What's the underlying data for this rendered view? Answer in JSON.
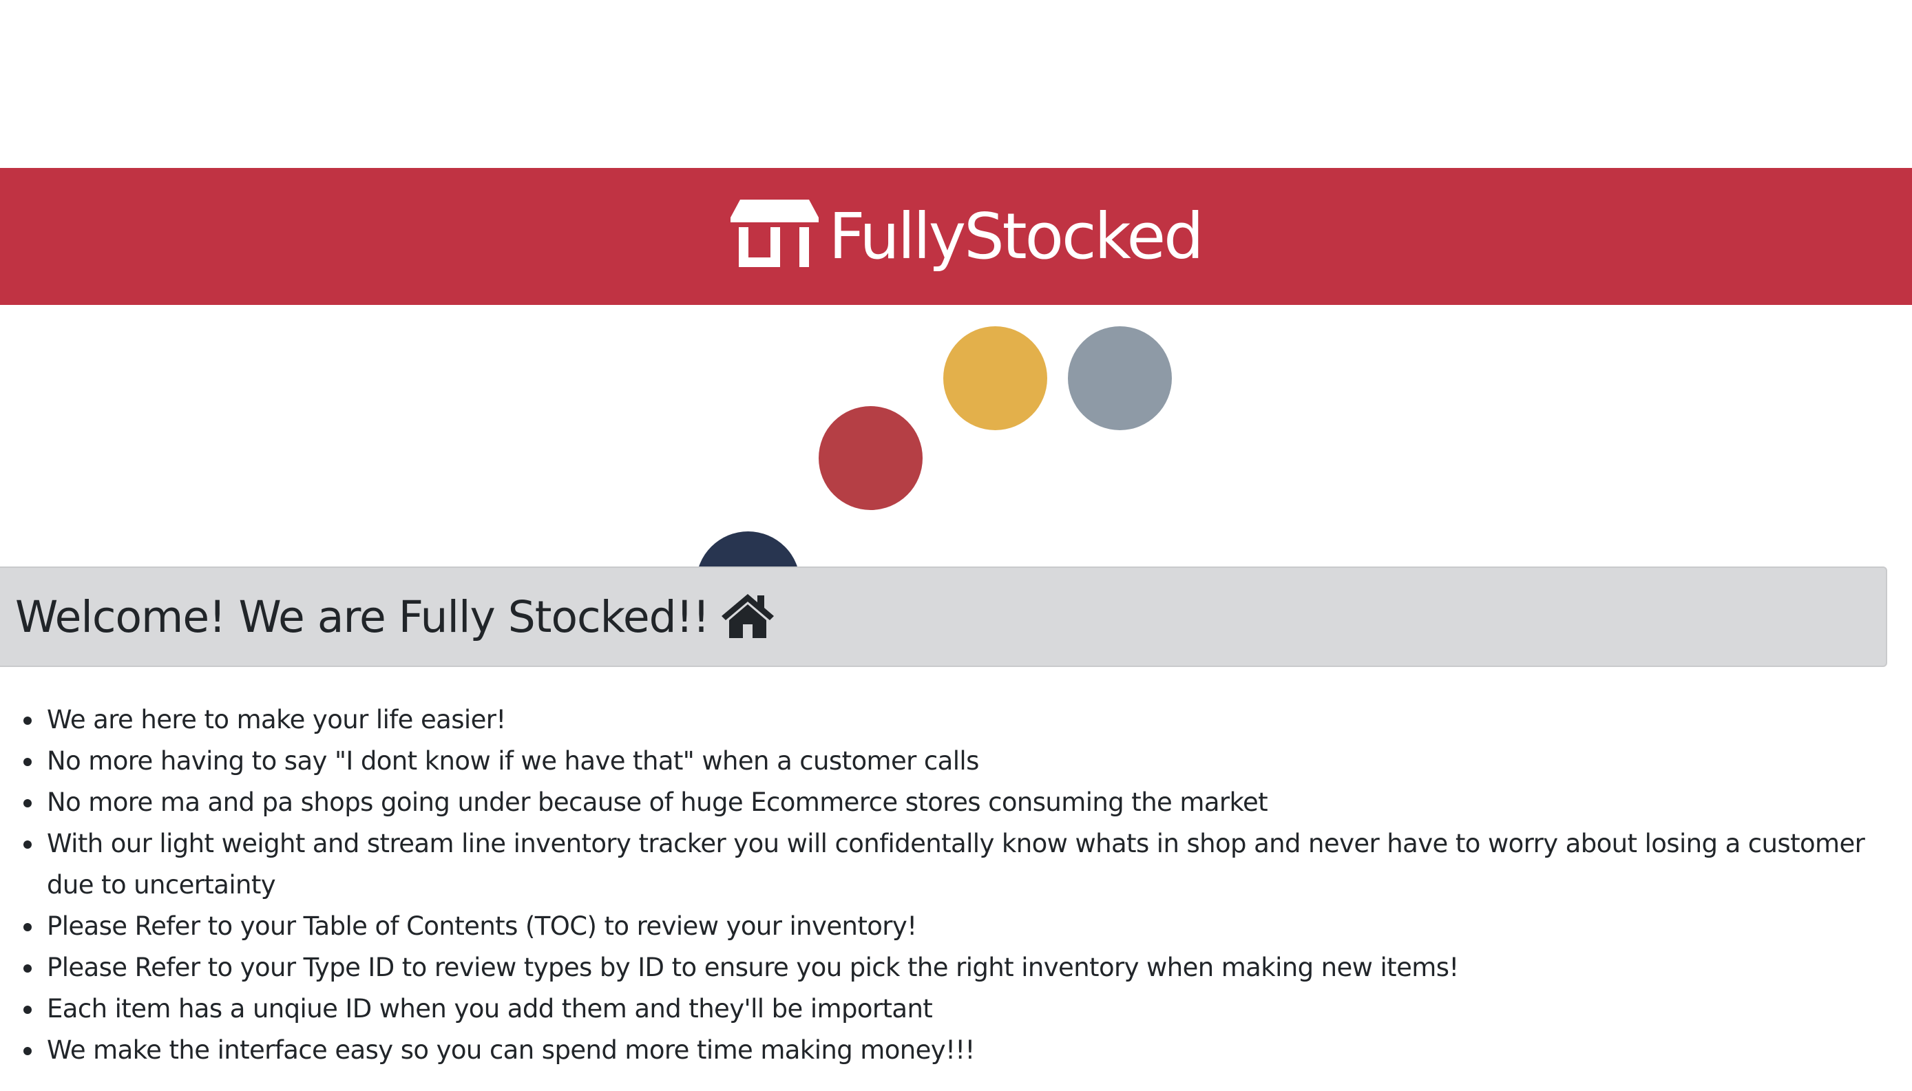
{
  "header": {
    "brand_name": "FullyStocked",
    "brand_icon": "store-icon",
    "background_color": "#c03343"
  },
  "decoration": {
    "dot_colors": [
      "#e3b04b",
      "#8e9aa6",
      "#b53f45",
      "#283550"
    ]
  },
  "jumbotron": {
    "title": "Welcome! We are Fully Stocked!!",
    "title_icon": "home-icon",
    "background_color": "#d8d9db"
  },
  "features": [
    "We are here to make your life easier!",
    "No more having to say \"I dont know if we have that\" when a customer calls",
    "No more ma and pa shops going under because of huge Ecommerce stores consuming the market",
    "With our light weight and stream line inventory tracker you will confidentally know whats in shop and never have to worry about losing a customer due to uncertainty",
    "Please Refer to your Table of Contents (TOC) to review your inventory!",
    "Please Refer to your Type ID to review types by ID to ensure you pick the right inventory when making new items!",
    "Each item has a unqiue ID when you add them and they'll be important",
    "We make the interface easy so you can spend more time making money!!!"
  ]
}
